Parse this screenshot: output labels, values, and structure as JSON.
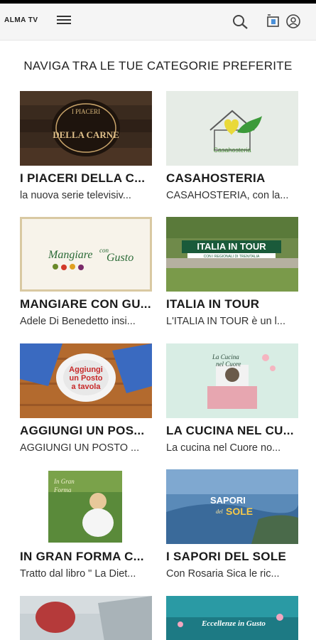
{
  "app": {
    "logo_text": "ALMA TV"
  },
  "section": {
    "title": "NAVIGA TRA LE TUE CATEGORIE PREFERITE"
  },
  "cards": [
    {
      "title": "I PIACERI DELLA C...",
      "desc": "la nuova serie televisiv...",
      "thumb_text": "I PIACERI DELLA CARNE"
    },
    {
      "title": "CASAHOSTERIA",
      "desc": "CASAHOSTERIA, con la...",
      "thumb_text": "Casahosteria"
    },
    {
      "title": "MANGIARE CON GU...",
      "desc": "Adele Di Benedetto insi...",
      "thumb_text": "Mangiare con Gusto"
    },
    {
      "title": "ITALIA IN TOUR",
      "desc": "L'ITALIA IN TOUR è un l...",
      "thumb_text": "ITALIA IN TOUR",
      "thumb_sub": "CON I REGIONALI DI TRENITALIA"
    },
    {
      "title": "AGGIUNGI UN POS...",
      "desc": "AGGIUNGI UN POSTO ...",
      "thumb_text": "Aggiungi un Posto a tavola"
    },
    {
      "title": "LA CUCINA NEL CU...",
      "desc": "La cucina nel Cuore no...",
      "thumb_text": "La Cucina nel Cuore"
    },
    {
      "title": "IN GRAN FORMA C...",
      "desc": "Tratto dal libro \" La Diet...",
      "thumb_text": "In Gran Forma"
    },
    {
      "title": "I SAPORI DEL SOLE",
      "desc": "Con Rosaria Sica le ric...",
      "thumb_text": "SAPORI del SOLE"
    },
    {
      "title": "",
      "desc": "",
      "thumb_text": ""
    },
    {
      "title": "",
      "desc": "",
      "thumb_text": "Eccellenze in Gusto"
    }
  ]
}
